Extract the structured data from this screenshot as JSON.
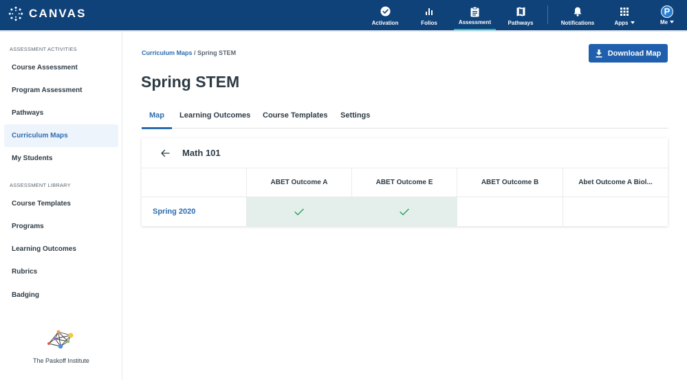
{
  "app": {
    "brand": "CANVAS"
  },
  "topnav": {
    "items": [
      {
        "label": "Activation",
        "icon": "check-circle-icon"
      },
      {
        "label": "Folios",
        "icon": "bar-chart-icon"
      },
      {
        "label": "Assessment",
        "icon": "clipboard-icon",
        "active": true
      },
      {
        "label": "Pathways",
        "icon": "map-icon"
      },
      {
        "label": "Notifications",
        "icon": "bell-icon"
      },
      {
        "label": "Apps",
        "icon": "grid-icon"
      },
      {
        "label": "Me",
        "icon": "avatar",
        "avatar_letter": "P"
      }
    ]
  },
  "sidebar": {
    "sections": [
      {
        "heading": "ASSESSMENT ACTIVITIES",
        "items": [
          {
            "label": "Course Assessment"
          },
          {
            "label": "Program Assessment"
          },
          {
            "label": "Pathways"
          },
          {
            "label": "Curriculum Maps",
            "active": true
          },
          {
            "label": "My Students"
          }
        ]
      },
      {
        "heading": "ASSESSMENT LIBRARY",
        "items": [
          {
            "label": "Course Templates"
          },
          {
            "label": "Programs"
          },
          {
            "label": "Learning Outcomes"
          },
          {
            "label": "Rubrics"
          },
          {
            "label": "Badging"
          }
        ]
      }
    ],
    "institution": "The Paskoff Institute"
  },
  "breadcrumb": {
    "parent": "Curriculum Maps",
    "separator": "/",
    "current": "Spring STEM"
  },
  "page": {
    "title": "Spring STEM",
    "download_label": "Download Map"
  },
  "tabs": [
    {
      "label": "Map",
      "active": true
    },
    {
      "label": "Learning Outcomes"
    },
    {
      "label": "Course Templates"
    },
    {
      "label": "Settings"
    }
  ],
  "map": {
    "course_title": "Math 101",
    "columns": [
      "ABET Outcome A",
      "ABET Outcome E",
      "ABET Outcome B",
      "Abet Outcome A Biol..."
    ],
    "rows": [
      {
        "term": "Spring 2020",
        "mapped": [
          true,
          true,
          false,
          false
        ]
      }
    ]
  },
  "colors": {
    "topbar": "#0f4279",
    "accent": "#2b6cb0",
    "active_nav_indicator": "#13c1ba",
    "mapped_cell": "#e4efec",
    "check": "#1f9d5c"
  }
}
